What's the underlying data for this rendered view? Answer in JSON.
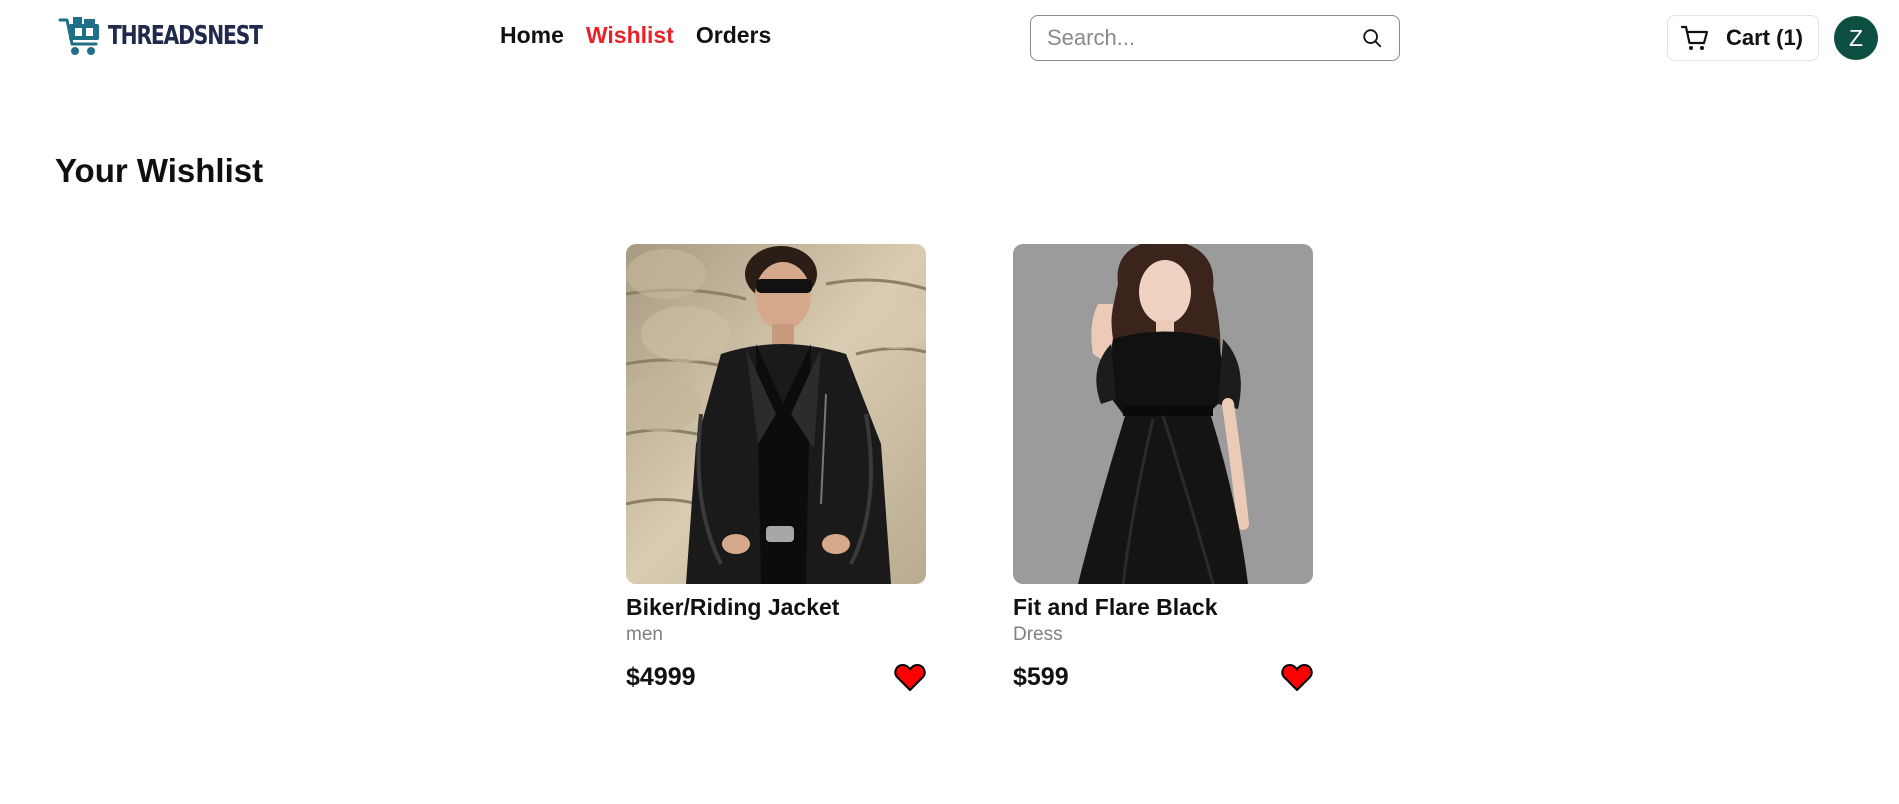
{
  "brand": {
    "name": "THREADSNEST",
    "logo_color": "#1f6f86"
  },
  "nav": {
    "items": [
      {
        "label": "Home",
        "active": false
      },
      {
        "label": "Wishlist",
        "active": true
      },
      {
        "label": "Orders",
        "active": false
      }
    ],
    "active_color": "#e8222b"
  },
  "search": {
    "placeholder": "Search...",
    "value": "",
    "icon": "search-icon"
  },
  "cart": {
    "label": "Cart (1)",
    "icon": "cart-icon"
  },
  "user": {
    "avatar_initial": "Z",
    "avatar_color": "#0d4f40"
  },
  "page": {
    "title": "Your Wishlist"
  },
  "wishlist": [
    {
      "name": "Biker/Riding Jacket",
      "category": "men",
      "price": "$4999",
      "favorited": true
    },
    {
      "name": "Fit and Flare Black",
      "category": "Dress",
      "price": "$599",
      "favorited": true
    }
  ],
  "colors": {
    "heart": "#ff0000"
  }
}
